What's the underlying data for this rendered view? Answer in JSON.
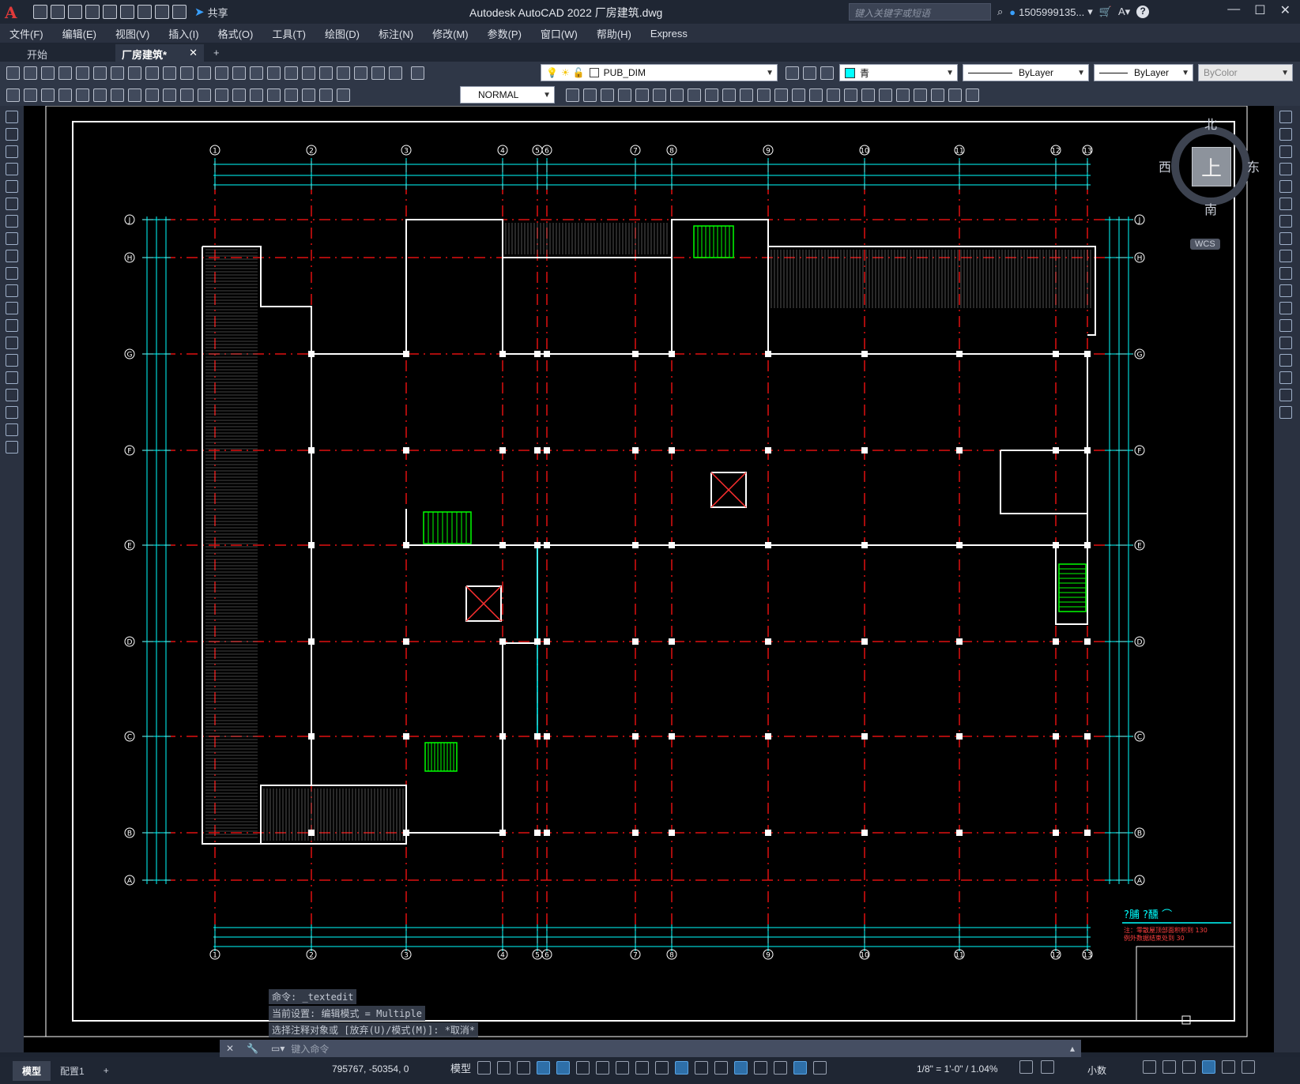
{
  "app": {
    "logo": "A",
    "window_title": "Autodesk AutoCAD 2022    厂房建筑.dwg",
    "share_label": "共享",
    "search_placeholder": "键入关键字或短语",
    "user": "1505999135...",
    "help": "?"
  },
  "window_controls": [
    "—",
    "☐",
    "✕"
  ],
  "menu": [
    "文件(F)",
    "编辑(E)",
    "视图(V)",
    "插入(I)",
    "格式(O)",
    "工具(T)",
    "绘图(D)",
    "标注(N)",
    "修改(M)",
    "参数(P)",
    "窗口(W)",
    "帮助(H)",
    "Express"
  ],
  "tabs": {
    "start": "开始",
    "active": "厂房建筑*",
    "close": "✕",
    "add": "+"
  },
  "toolbar": {
    "layer": "PUB_DIM",
    "color": "青",
    "linetype": "ByLayer",
    "lineweight": "ByLayer",
    "plotstyle": "ByColor",
    "dimstyle": "NORMAL"
  },
  "viewcube": {
    "north": "北",
    "south": "南",
    "west": "西",
    "east": "东",
    "top": "上",
    "wcs": "WCS"
  },
  "drawing": {
    "grid_top": [
      "1",
      "2",
      "3",
      "4",
      "5",
      "6",
      "7",
      "8",
      "9",
      "10",
      "11",
      "12",
      "13"
    ],
    "grid_side": [
      "J",
      "H",
      "G",
      "F",
      "E",
      "D",
      "C",
      "B",
      "A"
    ],
    "legend_title": "?脯 ?醺 ⌒",
    "legend_lines": [
      "注：零散屋顶部面积积到 130",
      "例外数据结束处到 30"
    ]
  },
  "command": {
    "history": [
      "命令: _textedit",
      "当前设置: 编辑模式 = Multiple",
      "选择注释对象或 [放弃(U)/模式(M)]: *取消*"
    ],
    "placeholder": "键入命令"
  },
  "status": {
    "model_tab": "模型",
    "layout_tab": "配置1",
    "add": "+",
    "coords": "795767, -50354, 0",
    "model": "模型",
    "scale": "1/8\" = 1'-0\" / 1.04%",
    "units": "小数"
  }
}
